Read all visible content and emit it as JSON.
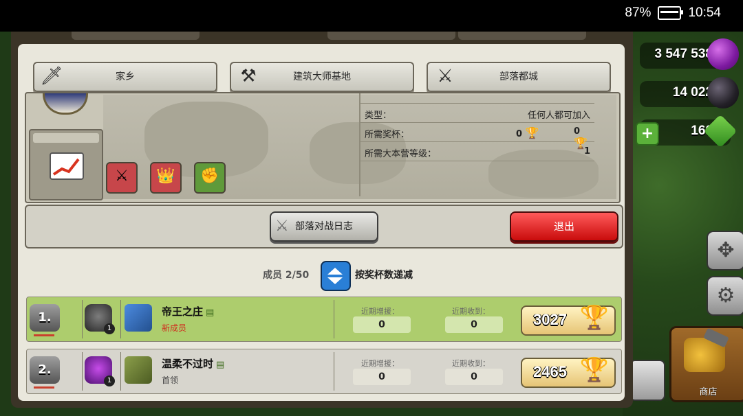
{
  "status": {
    "battery": "87%",
    "time": "10:54"
  },
  "resources": {
    "elixir": "3 547 538",
    "dark_elixir": "14 022",
    "gems": "160"
  },
  "shop": {
    "label": "商店"
  },
  "tabs": [
    {
      "label": "家乡",
      "icon": "sword-icon"
    },
    {
      "label": "建筑大师基地",
      "icon": "axes-icon"
    },
    {
      "label": "部落都城",
      "icon": "crossed-swords-icon"
    }
  ],
  "clan_info": {
    "rows": [
      {
        "key": "类型：",
        "value": "任何人都可加入"
      },
      {
        "key": "所需奖杯：",
        "value1": "0",
        "value2": "0"
      },
      {
        "key": "所需大本营等级：",
        "value": "1"
      }
    ]
  },
  "actions": {
    "war_log": "部落对战日志",
    "exit": "退出"
  },
  "members_header": {
    "count": "成员 2/50",
    "sort": "按奖杯数递减"
  },
  "members": [
    {
      "rank": "1.",
      "name": "帝王之庄",
      "role": "新成员",
      "league_level": "1",
      "donated_label": "近期增援：",
      "donated": "0",
      "received_label": "近期收到：",
      "received": "0",
      "trophies": "3027"
    },
    {
      "rank": "2.",
      "name": "温柔不过时",
      "role": "首领",
      "league_level": "1",
      "donated_label": "近期增援：",
      "donated": "0",
      "received_label": "近期收到：",
      "received": "0",
      "trophies": "2465"
    }
  ]
}
